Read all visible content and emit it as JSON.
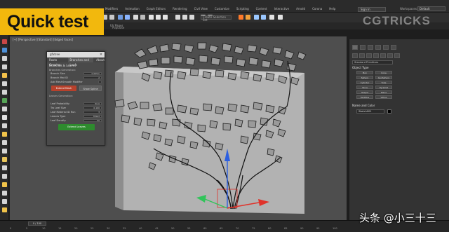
{
  "badge": {
    "text": "Quick test"
  },
  "watermark_brand": "CGTRICKS",
  "menubar": {
    "items": [
      "Modifiers",
      "Animation",
      "Graph Editors",
      "Rendering",
      "Civil View",
      "Customize",
      "Scripting",
      "Content",
      "Interactive",
      "Arnold",
      "Corona",
      "Help"
    ],
    "signin": "Sign In",
    "workspaces_label": "Workspaces:",
    "workspace_value": "Default"
  },
  "toolbar": {
    "selection_set": "Create Selection Set",
    "ui_label": "UV Paper",
    "populate": "Populate"
  },
  "viewport": {
    "label": "[+] [Perspective] [Standard] [Edged Faces]"
  },
  "dialog": {
    "title": "gfxtree",
    "tabs": [
      "Roots Growing",
      "Branches and Leafs",
      "About"
    ],
    "section_branches": "Branches & Leaves",
    "branches_generation": "Branches Generation:",
    "rows": [
      {
        "label": "Branch Size",
        "value": "0.005m"
      },
      {
        "label": "Branch Mat ID",
        "value": "2"
      },
      {
        "label": "Add MeshSmooth Modifier",
        "value": ""
      }
    ],
    "btn_extend": "Extend Mesh",
    "btn_show": "Show Spline",
    "leaves_generation": "Leaves Generation:",
    "leaf_rows": [
      {
        "label": "Leaf Probability",
        "value": "50.0"
      },
      {
        "label": "Tro Leaf Size",
        "value": "0.100"
      },
      {
        "label": "Leaf Material ID Run",
        "value": "3"
      },
      {
        "label": "Leaves Type",
        "value": "Mixed"
      },
      {
        "label": "Leaf Density",
        "value": "50"
      }
    ],
    "btn_extend_leaves": "Extend Leaves"
  },
  "cmdpanel": {
    "dropdown": "Standard Primitives",
    "object_type": "Object Type",
    "autogrid": "AutoGrid",
    "objects": [
      "Box",
      "Cone",
      "Sphere",
      "GeoSphere",
      "Cylinder",
      "Tube",
      "Torus",
      "Pyramid",
      "Teapot",
      "Plane",
      "TextPlus",
      "ViPlus"
    ],
    "name_and_color": "Name and Color",
    "name_value": "Sketch001"
  },
  "timeline": {
    "frame": "0 / 100",
    "ticks": [
      "0",
      "5",
      "10",
      "15",
      "20",
      "25",
      "30",
      "35",
      "40",
      "45",
      "50",
      "55",
      "60",
      "65",
      "70",
      "75",
      "80",
      "85",
      "90",
      "95",
      "100"
    ]
  },
  "overlay_text": "头条 @小三十三",
  "colors": {
    "badge_bg": "#f2b80d",
    "btn_red": "#b7412c",
    "btn_green": "#2e8b2e",
    "gizmo_x": "#e0322a",
    "gizmo_y": "#31c45a",
    "gizmo_z": "#2c5fe0"
  }
}
